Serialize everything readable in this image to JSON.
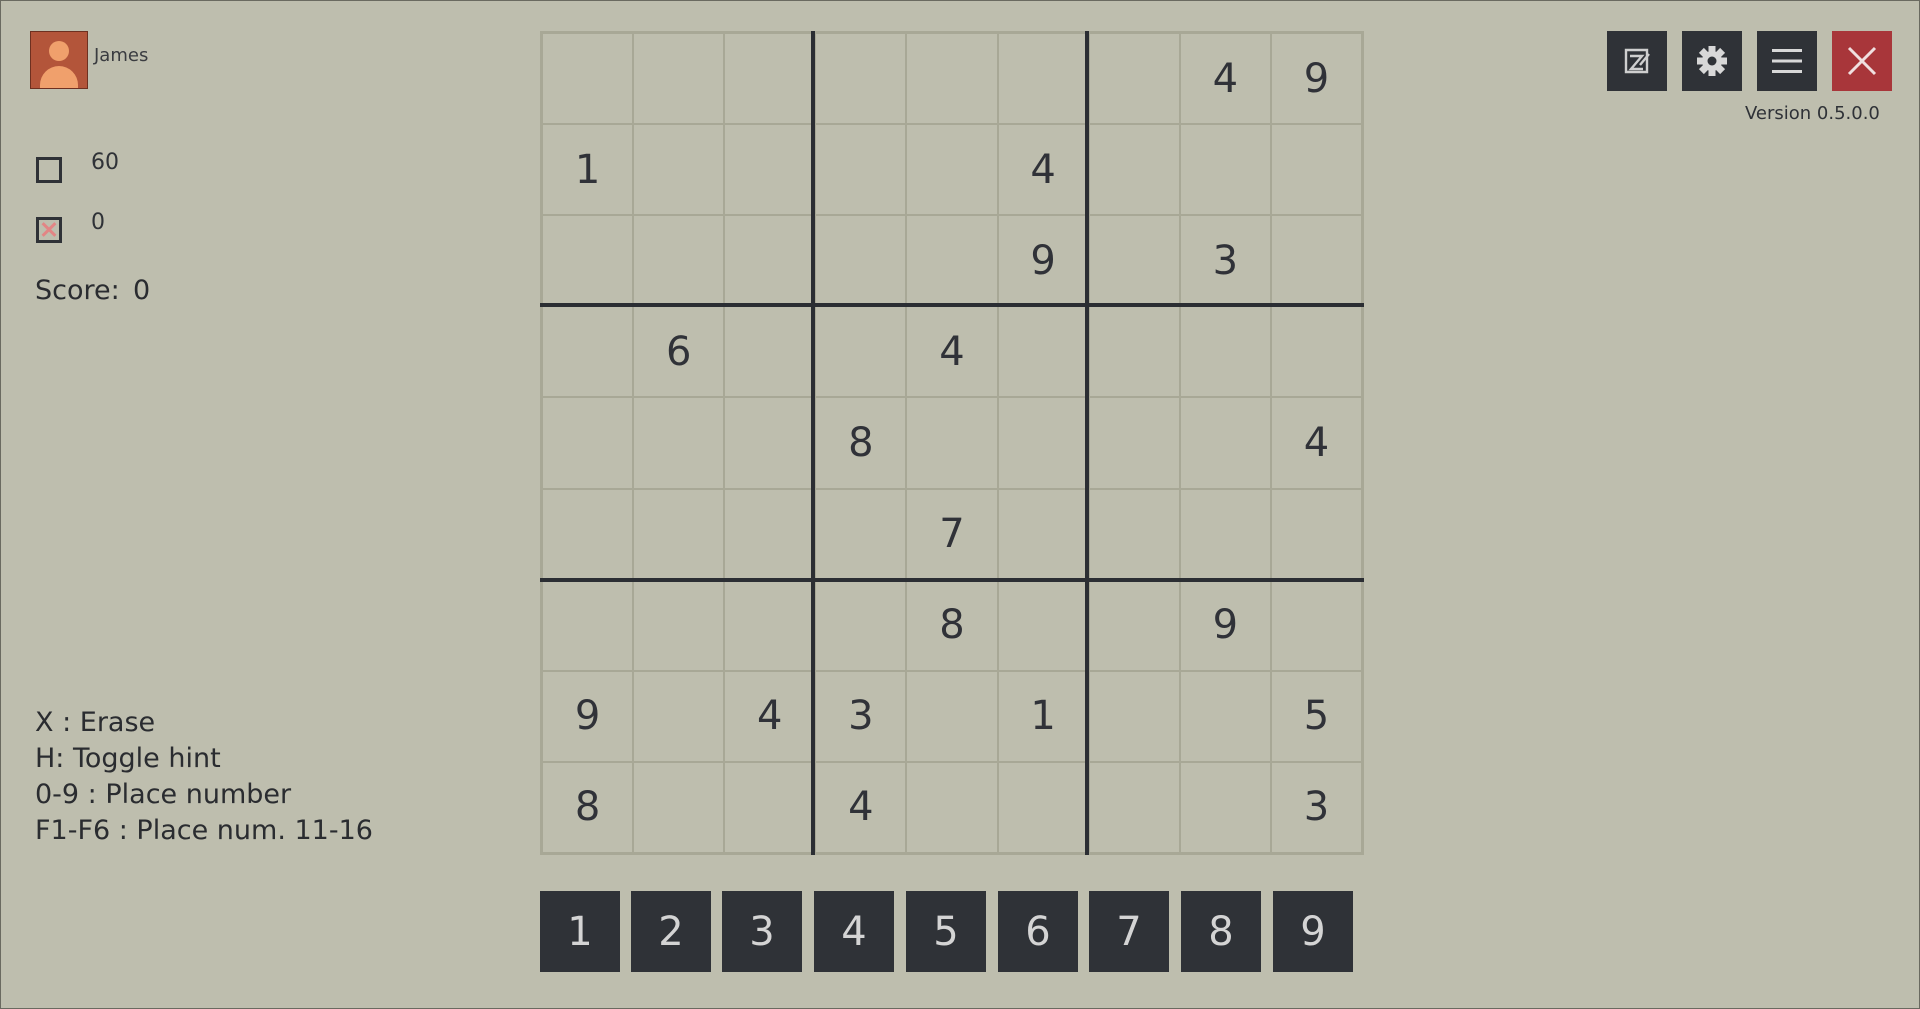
{
  "player": {
    "name": "James"
  },
  "stats": {
    "open_cells": "60",
    "mistakes": "0",
    "score_label": "Score:",
    "score_value": "0"
  },
  "help": [
    "X : Erase",
    "H: Toggle hint",
    "0-9 : Place number",
    "F1-F6 : Place num. 11-16"
  ],
  "board": [
    [
      "",
      "",
      "",
      "",
      "",
      "",
      "",
      "4",
      "9"
    ],
    [
      "1",
      "",
      "",
      "",
      "",
      "4",
      "",
      "",
      ""
    ],
    [
      "",
      "",
      "",
      "",
      "",
      "9",
      "",
      "3",
      ""
    ],
    [
      "",
      "6",
      "",
      "",
      "4",
      "",
      "",
      "",
      ""
    ],
    [
      "",
      "",
      "",
      "8",
      "",
      "",
      "",
      "",
      "4"
    ],
    [
      "",
      "",
      "",
      "",
      "7",
      "",
      "",
      "",
      ""
    ],
    [
      "",
      "",
      "",
      "",
      "8",
      "",
      "",
      "9",
      ""
    ],
    [
      "9",
      "",
      "4",
      "3",
      "",
      "1",
      "",
      "",
      "5"
    ],
    [
      "8",
      "",
      "",
      "4",
      "",
      "",
      "",
      "",
      "3"
    ]
  ],
  "numpad": [
    "1",
    "2",
    "3",
    "4",
    "5",
    "6",
    "7",
    "8",
    "9"
  ],
  "toolbar": {
    "icons": [
      "notes-icon",
      "gear-icon",
      "menu-icon",
      "close-icon"
    ],
    "version": "Version 0.5.0.0"
  },
  "colors": {
    "background": "#bebeae",
    "button": "#2f3237",
    "close_button": "#a8363a",
    "avatar": "#b3553a"
  }
}
